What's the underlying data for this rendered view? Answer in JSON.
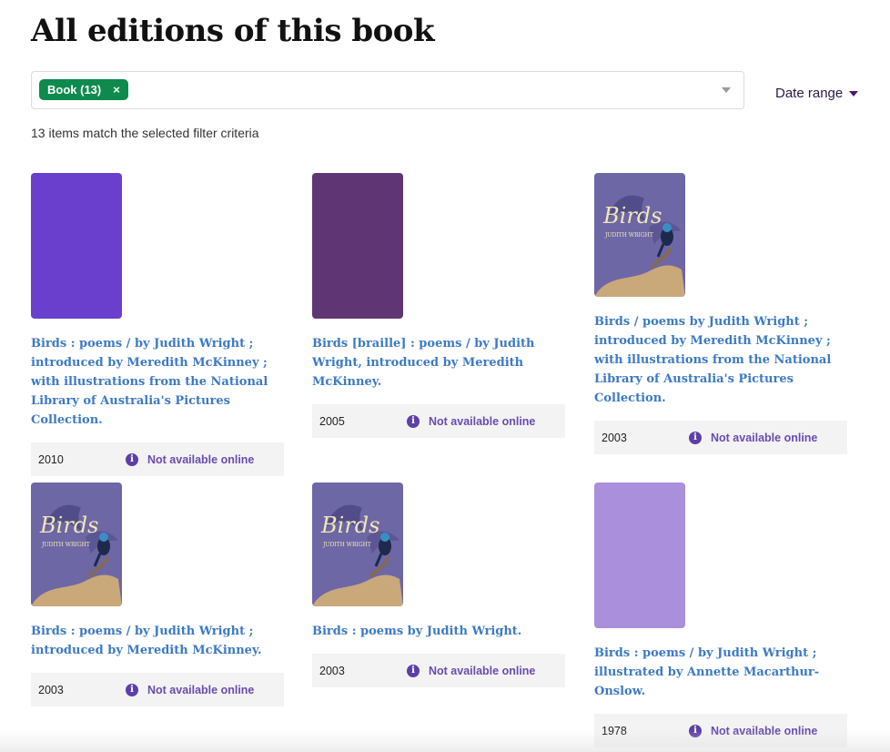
{
  "page": {
    "title": "All editions of this book"
  },
  "filter": {
    "chip_label": "Book (13)",
    "chip_remove": "×"
  },
  "date_range": {
    "label": "Date range"
  },
  "results": {
    "count_text": "13 items match the selected filter criteria"
  },
  "colors": {
    "accent_purple": "#6a3fce",
    "dark_purple": "#5f3574",
    "light_purple": "#a98fdc",
    "chip_green": "#0e8a4e",
    "link_blue": "#3d7ac3"
  },
  "editions": [
    {
      "title": "Birds : poems / by Judith Wright ; introduced by Meredith McKinney ; with illustrations from the National Library of Australia's Pictures Collection.",
      "year": "2010",
      "availability": "Not available online",
      "cover": "placeholder",
      "cover_color": "#6a3fce"
    },
    {
      "title": "Birds [braille] : poems / by Judith Wright, introduced by Meredith McKinney.",
      "year": "2005",
      "availability": "Not available online",
      "cover": "placeholder",
      "cover_color": "#5f3574"
    },
    {
      "title": "Birds / poems by Judith Wright ; introduced by Meredith McKinney ; with illustrations from the National Library of Australia's Pictures Collection.",
      "year": "2003",
      "availability": "Not available online",
      "cover": "image",
      "cover_text": "Birds",
      "cover_author": "JUDITH WRIGHT"
    },
    {
      "title": "Birds : poems / by Judith Wright ; introduced by Meredith McKinney.",
      "year": "2003",
      "availability": "Not available online",
      "cover": "image",
      "cover_text": "Birds",
      "cover_author": "JUDITH WRIGHT"
    },
    {
      "title": "Birds : poems by Judith Wright.",
      "year": "2003",
      "availability": "Not available online",
      "cover": "image",
      "cover_text": "Birds",
      "cover_author": "JUDITH WRIGHT"
    },
    {
      "title": "Birds : poems / by Judith Wright ; illustrated by Annette Macarthur-Onslow.",
      "year": "1978",
      "availability": "Not available online",
      "cover": "placeholder",
      "cover_color": "#a98fdc"
    }
  ]
}
